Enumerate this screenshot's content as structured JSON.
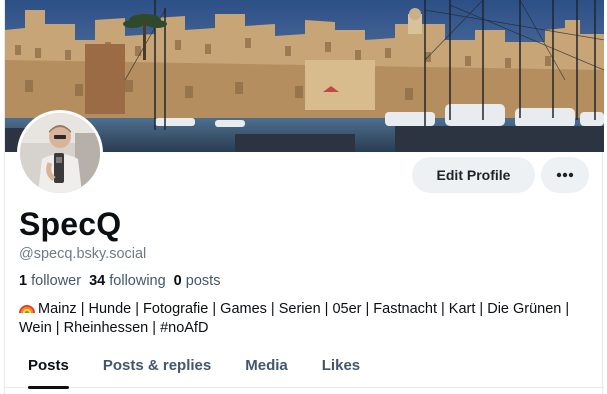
{
  "profile": {
    "display_name": "SpecQ",
    "handle": "@specq.bsky.social",
    "followers_count": "1",
    "followers_label": "follower",
    "following_count": "34",
    "following_label": "following",
    "posts_count": "0",
    "posts_label": "posts",
    "bio_emoji": "rainbow-icon",
    "bio": "Mainz | Hunde | Fotografie | Games | Serien | 05er | Fastnacht | Kart | Die Grünen | Wein | Rheinhessen | #noAfD"
  },
  "actions": {
    "edit_label": "Edit Profile",
    "more_icon": "more-horizontal-icon"
  },
  "tabs": [
    {
      "label": "Posts",
      "active": true
    },
    {
      "label": "Posts & replies",
      "active": false
    },
    {
      "label": "Media",
      "active": false
    },
    {
      "label": "Likes",
      "active": false
    }
  ],
  "colors": {
    "accent_text": "#0b0f14",
    "muted_text": "#6f7a86",
    "button_bg": "#eef1f4",
    "sky": "#3e5f8f"
  }
}
